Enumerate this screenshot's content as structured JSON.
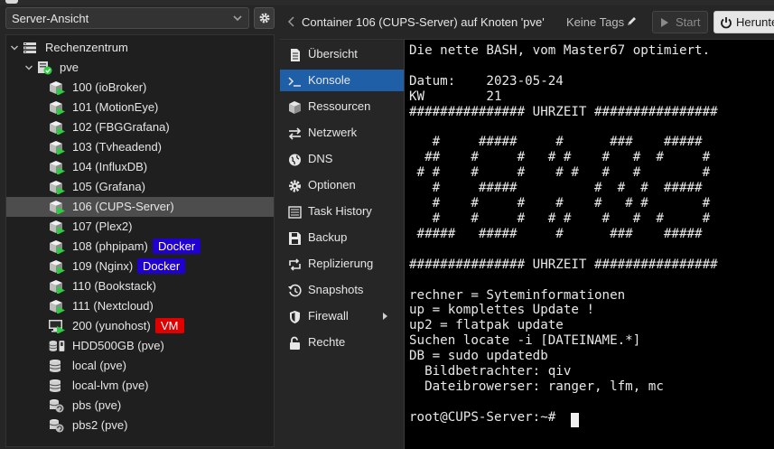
{
  "colors": {
    "accent_blue": "#1f5fa8",
    "docker_tag": "#2000d0",
    "vm_tag": "#e00000",
    "running_green": "#2ecc40"
  },
  "sidebar": {
    "view_select": "Server-Ansicht",
    "tree": [
      {
        "label": "Rechenzentrum",
        "icon": "datacenter-icon"
      },
      {
        "label": "pve",
        "icon": "node-online-icon"
      },
      {
        "label": "100 (ioBroker)",
        "icon": "container-running-icon"
      },
      {
        "label": "101 (MotionEye)",
        "icon": "container-running-icon"
      },
      {
        "label": "102 (FBGGrafana)",
        "icon": "container-running-icon"
      },
      {
        "label": "103 (Tvheadend)",
        "icon": "container-running-icon"
      },
      {
        "label": "104 (InfluxDB)",
        "icon": "container-running-icon"
      },
      {
        "label": "105 (Grafana)",
        "icon": "container-running-icon"
      },
      {
        "label": "106 (CUPS-Server)",
        "icon": "container-running-icon"
      },
      {
        "label": "107 (Plex2)",
        "icon": "container-running-icon"
      },
      {
        "label": "108 (phpipam)",
        "icon": "container-running-icon",
        "tag": "Docker"
      },
      {
        "label": "109 (Nginx)",
        "icon": "container-running-icon",
        "tag": "Docker"
      },
      {
        "label": "110 (Bookstack)",
        "icon": "container-running-icon"
      },
      {
        "label": "111 (Nextcloud)",
        "icon": "container-running-icon"
      },
      {
        "label": "200 (yunohost)",
        "icon": "vm-running-icon",
        "tag": "VM"
      },
      {
        "label": "HDD500GB (pve)",
        "icon": "storage-usb-icon"
      },
      {
        "label": "local (pve)",
        "icon": "storage-icon"
      },
      {
        "label": "local-lvm (pve)",
        "icon": "storage-icon"
      },
      {
        "label": "pbs (pve)",
        "icon": "pbs-storage-icon"
      },
      {
        "label": "pbs2 (pve)",
        "icon": "pbs-storage-icon"
      }
    ]
  },
  "header": {
    "title": "Container 106 (CUPS-Server) auf Knoten 'pve'",
    "tags_label": "Keine Tags",
    "start_label": "Start",
    "shutdown_label": "Herunte"
  },
  "nav": {
    "items": [
      {
        "label": "Übersicht",
        "icon": "summary-icon"
      },
      {
        "label": "Konsole",
        "icon": "console-icon"
      },
      {
        "label": "Ressourcen",
        "icon": "resources-icon"
      },
      {
        "label": "Netzwerk",
        "icon": "network-icon"
      },
      {
        "label": "DNS",
        "icon": "globe-icon"
      },
      {
        "label": "Optionen",
        "icon": "gear-icon"
      },
      {
        "label": "Task History",
        "icon": "list-icon"
      },
      {
        "label": "Backup",
        "icon": "floppy-icon"
      },
      {
        "label": "Replizierung",
        "icon": "retweet-icon"
      },
      {
        "label": "Snapshots",
        "icon": "history-icon"
      },
      {
        "label": "Firewall",
        "icon": "shield-icon"
      },
      {
        "label": "Rechte",
        "icon": "unlock-icon"
      }
    ],
    "active_index": 1
  },
  "console": {
    "lines": [
      "Die nette BASH, vom Master67 optimiert.",
      "",
      "Datum:    2023-05-24",
      "KW        21",
      "############### UHRZEIT ################",
      "",
      "   #     #####     #      ###    #####",
      "  ##    #     #   # #    #   #  #     #",
      " # #    #     #    # #   #   #        #",
      "   #     #####          #  #  #  #####",
      "   #    #     #    #    #   # #       #",
      "   #    #     #   # #    #   #  #     #",
      " #####   #####     #      ###    #####",
      "",
      "############### UHRZEIT ################",
      "",
      "rechner = Syteminformationen",
      "up = komplettes Update !",
      "up2 = flatpak update",
      "Suchen locate -i [DATEINAME.*]",
      "DB = sudo updatedb",
      "  Bildbetrachter: qiv",
      "  Dateibrowerser: ranger, lfm, mc",
      "",
      "root@CUPS-Server:~# "
    ]
  }
}
